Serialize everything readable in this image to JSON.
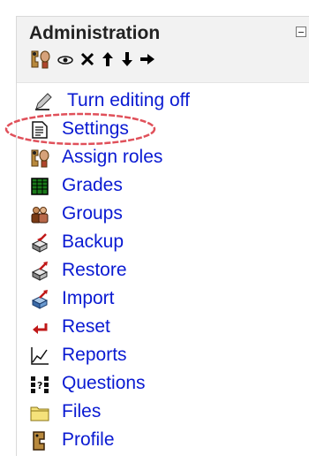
{
  "block": {
    "title": "Administration",
    "collapse_icon": "minus-box-icon",
    "tool_icons": [
      "assign-roles-icon",
      "eye-icon",
      "close-x-icon",
      "up-arrow-icon",
      "down-arrow-icon",
      "right-arrow-icon"
    ]
  },
  "menu": {
    "items": [
      {
        "label": "Turn editing off",
        "icon": "pencil-icon"
      },
      {
        "label": "Settings",
        "icon": "document-icon"
      },
      {
        "label": "Assign roles",
        "icon": "assign-roles-icon"
      },
      {
        "label": "Grades",
        "icon": "gradebook-icon"
      },
      {
        "label": "Groups",
        "icon": "people-icon"
      },
      {
        "label": "Backup",
        "icon": "backup-icon"
      },
      {
        "label": "Restore",
        "icon": "restore-icon"
      },
      {
        "label": "Import",
        "icon": "import-icon"
      },
      {
        "label": "Reset",
        "icon": "reset-arrow-icon"
      },
      {
        "label": "Reports",
        "icon": "chart-icon"
      },
      {
        "label": "Questions",
        "icon": "questions-icon"
      },
      {
        "label": "Files",
        "icon": "folder-icon"
      },
      {
        "label": "Profile",
        "icon": "profile-icon"
      }
    ]
  },
  "colors": {
    "link": "#0a1ad2",
    "highlight": "#e0505a",
    "header_bg": "#f2f2f2"
  }
}
